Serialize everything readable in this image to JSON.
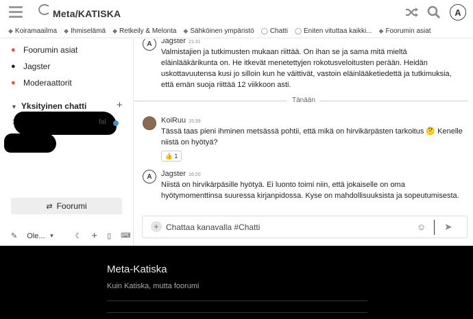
{
  "header": {
    "site_title": "Meta/KATISKA",
    "avatar_letter": "A"
  },
  "categories": [
    {
      "label": "Koiramaailma",
      "icon": "paw-icon"
    },
    {
      "label": "Ihmiselämä",
      "icon": "people-icon"
    },
    {
      "label": "Retkeily & Melonta",
      "icon": "tree-icon"
    },
    {
      "label": "Sähköinen ympäristö",
      "icon": "plug-icon"
    },
    {
      "label": "Chatti",
      "icon": "chat-icon"
    },
    {
      "label": "Eniten vituttaa kaikki...",
      "icon": "chat-icon"
    },
    {
      "label": "Foorumin asiat",
      "icon": "flag-icon"
    }
  ],
  "sidebar": {
    "channels": [
      {
        "label": "Foorumin asiat",
        "color": "#e64a4a"
      },
      {
        "label": "Jagster",
        "color": "#222222"
      },
      {
        "label": "Moderaattorit",
        "color": "#e8572a"
      }
    ],
    "private_chat_title": "Yksityinen chatti",
    "redacted_count": "3",
    "redacted_suffix": "fal",
    "forum_button": "Foorumi",
    "footer_label": "Ole..."
  },
  "chat": {
    "messages": [
      {
        "author": "Jagster",
        "time": "21:31",
        "text": "Valmistajien ja tutkimusten mukaan riittää. On ihan se ja sama mitä mieltä eläinlääkärikunta on. He itkevät menetettyjen rokotusveloitusten perään. Heidän uskottavuutensa kusi jo silloin kun he väittivät, vastoin eläinlääketiedettä ja tutkimuksia, että emän suoja riittää 12 viikkoon asti."
      },
      {
        "author": "KoiRuu",
        "time": "15:39",
        "text": "Tässä taas pieni ihminen metsässä pohtii, että mikä on hirvikärpästen tarkoitus 🤔 Kenelle niistä on hyötyä?",
        "reaction": "👍 1"
      },
      {
        "author": "Jagster",
        "time": "16:20",
        "text": "Niistä on hirvikärpäsille hyötyä. Ei luonto toimi niin, että jokaiselle on oma hyötymomenttinsa suuressa kirjanpidossa. Kyse on mahdollisuuksista ja sopeutumisesta."
      }
    ],
    "divider_label": "Tänään",
    "composer_placeholder": "Chattaa kanavalla #Chatti"
  },
  "footer": {
    "title": "Meta-Katiska",
    "subtitle": "Kuin Katiska, mutta foorumi"
  }
}
